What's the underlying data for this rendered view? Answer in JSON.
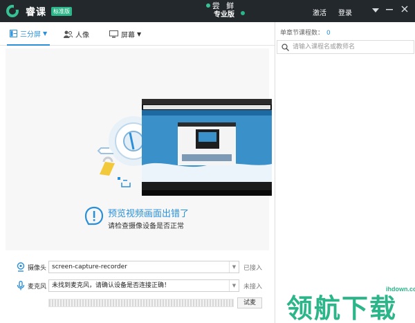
{
  "titlebar": {
    "app_name": "睿课",
    "edition": "标准版",
    "promo_line1": "尝 鲜",
    "promo_line2": "专业版",
    "activate": "激活",
    "login": "登录",
    "icons": [
      "menu-icon",
      "minimize-icon",
      "close-icon"
    ]
  },
  "tabs": [
    {
      "label": "三分屏",
      "icon": "layout-icon",
      "active": true,
      "has_caret": true
    },
    {
      "label": "人像",
      "icon": "person-icon",
      "active": false,
      "has_caret": false
    },
    {
      "label": "屏幕",
      "icon": "monitor-icon",
      "active": false,
      "has_caret": true
    }
  ],
  "preview": {
    "error_title": "预览视频画面出错了",
    "error_sub": "请检查摄像设备是否正常"
  },
  "devices": {
    "camera": {
      "label": "摄像头",
      "value": "screen-capture-recorder",
      "status": "已接入"
    },
    "microphone": {
      "label": "麦克风",
      "value": "未找到麦克风，请确认设备是否连接正确！",
      "status": "未接入"
    },
    "test_label": "试麦"
  },
  "sidebar": {
    "count_label": "单章节课程数：",
    "count_value": "0",
    "search_placeholder": "请输入课程名或教师名"
  },
  "watermark": {
    "text": "领航下载",
    "site": "ihdown.com"
  },
  "colors": {
    "titlebar": "#23282d",
    "accent": "#2a8fd8",
    "brand_green": "#36c293"
  }
}
